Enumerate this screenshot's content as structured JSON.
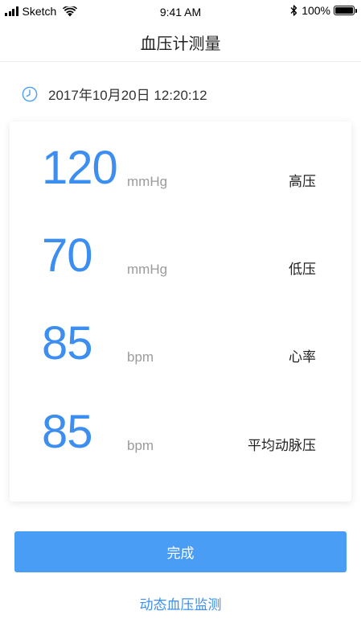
{
  "status_bar": {
    "carrier": "Sketch",
    "time": "9:41 AM",
    "battery": "100%"
  },
  "nav": {
    "title": "血压计测量"
  },
  "measurement": {
    "datetime": "2017年10月20日 12:20:12"
  },
  "metrics": [
    {
      "value": "120",
      "unit": "mmHg",
      "label": "高压"
    },
    {
      "value": "70",
      "unit": "mmHg",
      "label": "低压"
    },
    {
      "value": "85",
      "unit": "bpm",
      "label": "心率"
    },
    {
      "value": "85",
      "unit": "bpm",
      "label": "平均动脉压"
    }
  ],
  "actions": {
    "done_label": "完成",
    "dynamic_label": "动态血压监测"
  },
  "colors": {
    "accent": "#3c8ff0",
    "button": "#4a9df5"
  },
  "icons": {
    "clock": "clock-icon",
    "wifi": "wifi-icon",
    "bluetooth": "bluetooth-icon",
    "battery": "battery-icon",
    "signal": "signal-icon"
  }
}
